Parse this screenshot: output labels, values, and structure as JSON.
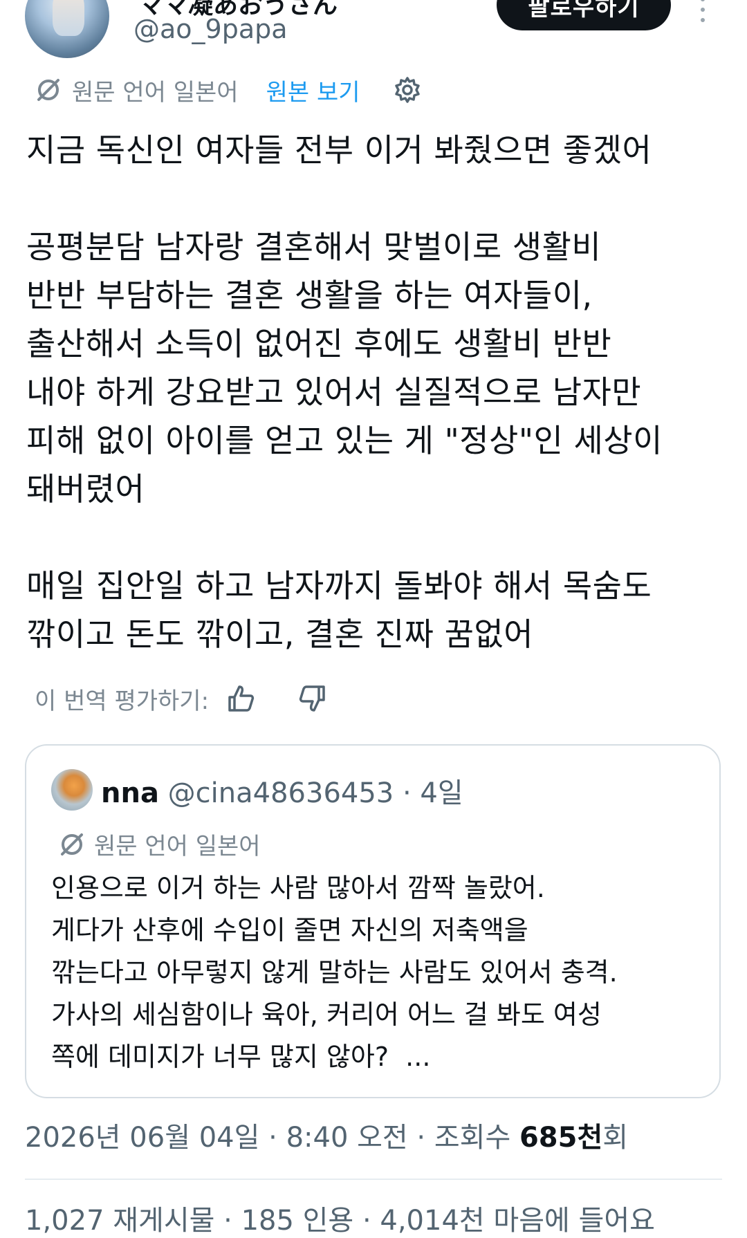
{
  "header": {
    "display_name": "ママ凝あおうさん",
    "handle": "@ao_9papa",
    "follow_label": "팔로우하기"
  },
  "translation": {
    "label": "원문 언어 일본어",
    "view_original": "원본 보기"
  },
  "tweet": {
    "body": "지금 독신인 여자들 전부 이거 봐줬으면 좋겠어\n\n공평분담 남자랑 결혼해서 맞벌이로 생활비\n반반 부담하는 결혼 생활을 하는 여자들이,\n출산해서 소득이 없어진 후에도 생활비 반반\n내야 하게 강요받고 있어서 실질적으로 남자만\n피해 없이 아이를 얻고 있는 게 \"정상\"인 세상이\n돼버렸어\n\n매일 집안일 하고 남자까지 돌봐야 해서 목숨도\n깎이고 돈도 깎이고, 결혼 진짜 꿈없어"
  },
  "rate": {
    "label": "이 번역 평가하기:"
  },
  "quote": {
    "name": "nna",
    "handle_time": "@cina48636453 · 4일",
    "translation_label": "원문 언어 일본어",
    "body": "인용으로 이거 하는 사람 많아서 깜짝 놀랐어.\n게다가 산후에 수입이 줄면 자신의 저축액을\n깎는다고 아무렇지 않게 말하는 사람도 있어서 충격.\n가사의 세심함이나 육아, 커리어 어느 걸 봐도 여성\n쪽에 데미지가 너무 많지 않아?  ..."
  },
  "meta": {
    "datetime": "2026년 06월 04일 · 8:40 오전 · 조회수 ",
    "views": "685천",
    "views_suffix": "회"
  },
  "stats": {
    "text": "1,027 재게시물 · 185 인용 · 4,014천 마음에 들어요"
  },
  "colors": {
    "accent": "#1d9bf0",
    "text": "#0f1419",
    "secondary": "#536471"
  }
}
